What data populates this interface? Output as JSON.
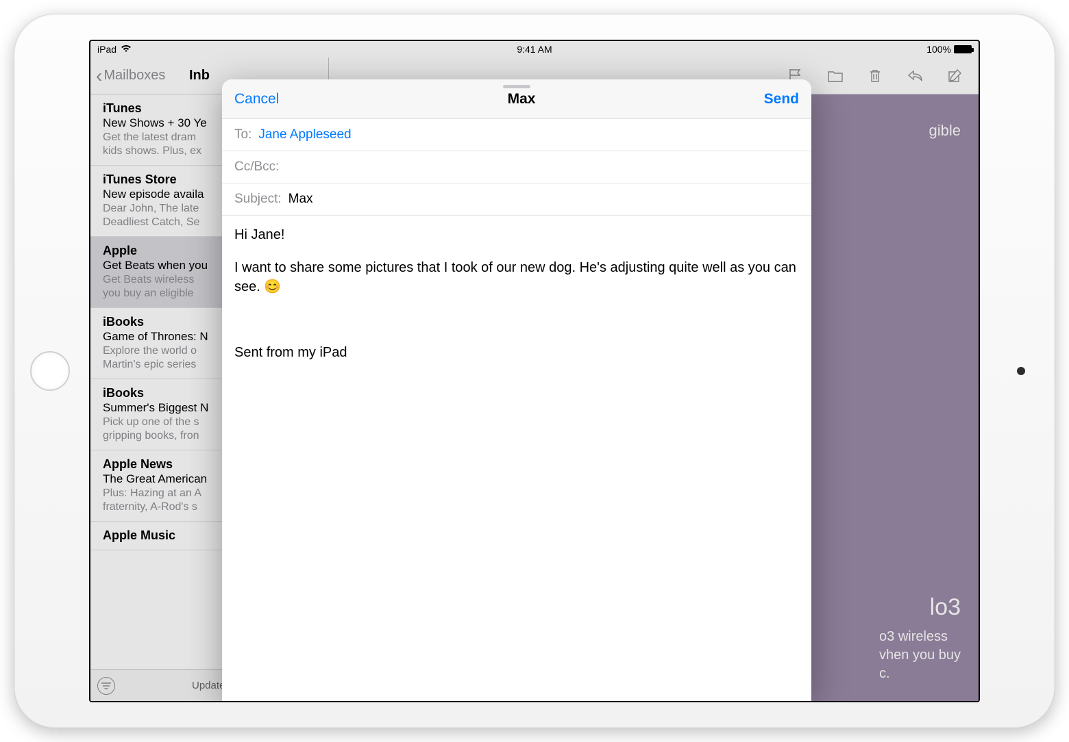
{
  "statusbar": {
    "device": "iPad",
    "time": "9:41 AM",
    "battery": "100%"
  },
  "sidebar": {
    "back_label": "Mailboxes",
    "title": "Inb",
    "footer_status": "Updated",
    "items": [
      {
        "sender": "iTunes",
        "subject": "New Shows + 30 Ye",
        "preview": "Get the latest dram\nkids shows. Plus, ex"
      },
      {
        "sender": "iTunes Store",
        "subject": "New episode availa",
        "preview": "Dear John, The late\nDeadliest Catch, Se"
      },
      {
        "sender": "Apple",
        "subject": "Get Beats when you",
        "preview": "Get Beats wireless\nyou buy an eligible"
      },
      {
        "sender": "iBooks",
        "subject": "Game of Thrones: N",
        "preview": "Explore the world o\nMartin's epic series"
      },
      {
        "sender": "iBooks",
        "subject": "Summer's Biggest N",
        "preview": "Pick up one of the s\ngripping books, fron"
      },
      {
        "sender": "Apple News",
        "subject": "The Great American",
        "preview": "Plus: Hazing at an A\nfraternity, A-Rod's s"
      },
      {
        "sender": "Apple Music",
        "subject": "",
        "preview": ""
      }
    ]
  },
  "reading": {
    "snippet_top": "gible",
    "headline_fragment": "lo3",
    "body_fragment": "o3 wireless\nvhen you buy\nc."
  },
  "compose": {
    "cancel": "Cancel",
    "send": "Send",
    "title": "Max",
    "to_label": "To:",
    "to_value": "Jane Appleseed",
    "ccbcc_label": "Cc/Bcc:",
    "subject_label": "Subject:",
    "subject_value": "Max",
    "body_greeting": "Hi Jane!",
    "body_main": "I want to share some pictures that I took of our new dog. He's adjusting quite well as you can see. 😊",
    "signature": "Sent from my iPad"
  }
}
